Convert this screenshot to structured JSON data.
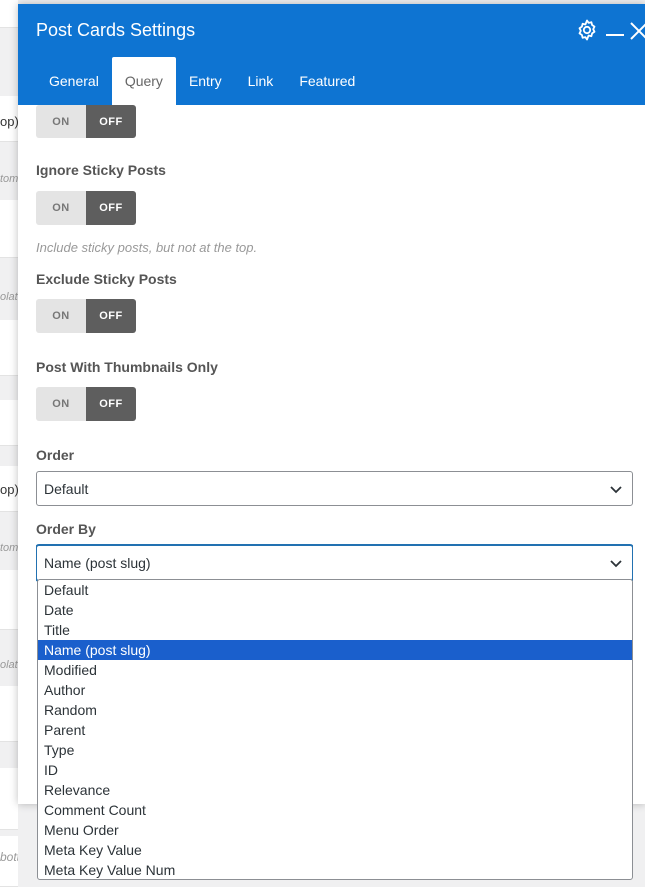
{
  "background": {
    "fragments": [
      "op)",
      "tom",
      "olate",
      "op)",
      "tom",
      "olate",
      "bottom"
    ]
  },
  "modal": {
    "title": "Post Cards Settings",
    "header_icons": [
      "gear-icon",
      "minimize-icon",
      "close-icon"
    ],
    "tabs": [
      {
        "label": "General",
        "active": false
      },
      {
        "label": "Query",
        "active": true
      },
      {
        "label": "Entry",
        "active": false
      },
      {
        "label": "Link",
        "active": false
      },
      {
        "label": "Featured",
        "active": false
      }
    ]
  },
  "toggles": [
    {
      "label": "",
      "on": "ON",
      "off": "OFF",
      "value": "OFF"
    },
    {
      "label": "Ignore Sticky Posts",
      "on": "ON",
      "off": "OFF",
      "value": "OFF",
      "help": "Include sticky posts, but not at the top."
    },
    {
      "label": "Exclude Sticky Posts",
      "on": "ON",
      "off": "OFF",
      "value": "OFF"
    },
    {
      "label": "Post With Thumbnails Only",
      "on": "ON",
      "off": "OFF",
      "value": "OFF"
    }
  ],
  "order": {
    "label": "Order",
    "value": "Default"
  },
  "order_by": {
    "label": "Order By",
    "value": "Name (post slug)",
    "options": [
      "Default",
      "Date",
      "Title",
      "Name (post slug)",
      "Modified",
      "Author",
      "Random",
      "Parent",
      "Type",
      "ID",
      "Relevance",
      "Comment Count",
      "Menu Order",
      "Meta Key Value",
      "Meta Key Value Num"
    ],
    "selected_index": 3
  },
  "colors": {
    "header": "#0e74d2",
    "selected_option": "#1a5fcc",
    "toggle_off": "#5e5e5e"
  }
}
